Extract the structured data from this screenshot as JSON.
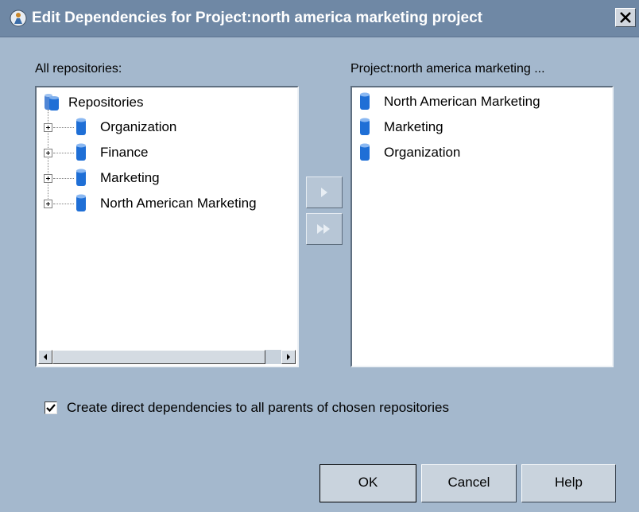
{
  "window": {
    "title": "Edit Dependencies for Project:north america marketing project"
  },
  "left": {
    "label": "All repositories:",
    "root_label": "Repositories",
    "items": [
      {
        "label": "Organization"
      },
      {
        "label": "Finance"
      },
      {
        "label": "Marketing"
      },
      {
        "label": "North American Marketing"
      }
    ]
  },
  "right": {
    "label": "Project:north america marketing ...",
    "items": [
      {
        "label": "North American Marketing"
      },
      {
        "label": "Marketing"
      },
      {
        "label": "Organization"
      }
    ]
  },
  "buttons": {
    "ok": "OK",
    "cancel": "Cancel",
    "help": "Help"
  },
  "checkbox": {
    "label": "Create direct dependencies to all parents of chosen repositories",
    "checked": true
  },
  "colors": {
    "background": "#a4b8cd",
    "titlebar": "#6f88a5",
    "db_icon": "#1f6fd6"
  }
}
